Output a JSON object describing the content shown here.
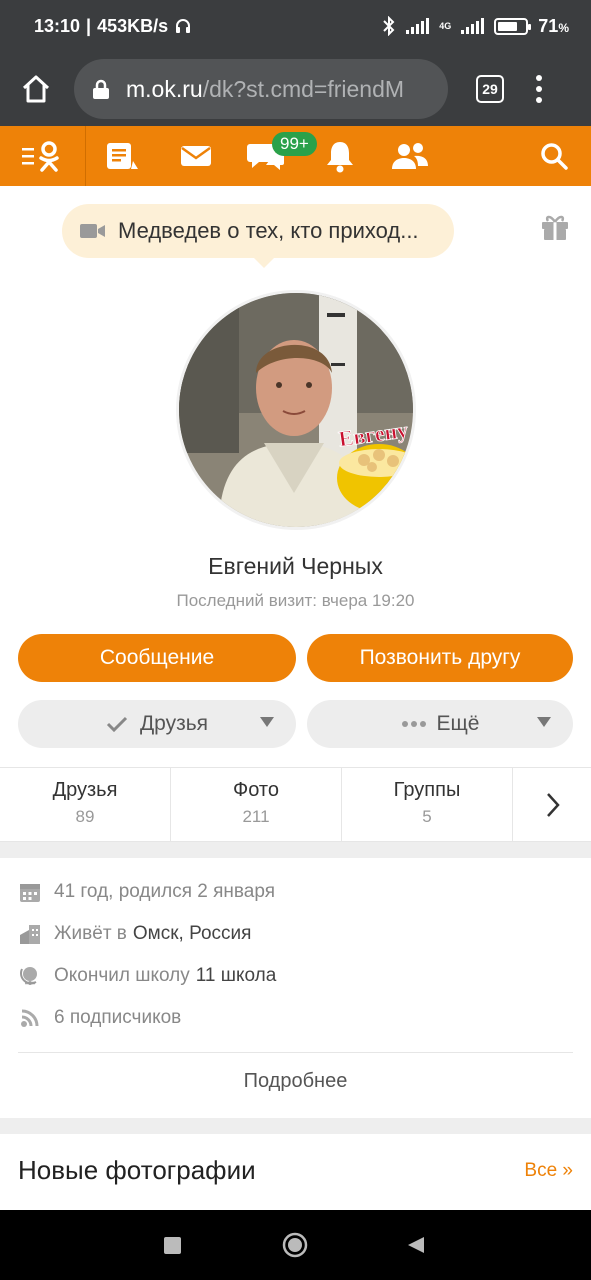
{
  "status_bar": {
    "time": "13:10",
    "speed": "453KB/s",
    "network": "4G",
    "battery": "71",
    "battery_unit": "%",
    "battery_level": 0.71
  },
  "browser": {
    "url_host": "m.ok.ru",
    "url_path": "/dk?st.cmd=friendM",
    "tab_count": "29"
  },
  "toolbar": {
    "items": [
      "menu-icon",
      "feed-icon",
      "mail-icon",
      "chat-icon",
      "bell-icon",
      "friends-icon",
      "search-icon"
    ],
    "chat_badge": "99+",
    "accent": "#ee8208",
    "badge_color": "#2aa14a"
  },
  "status_bubble": {
    "text": "Медведев о тех, кто приход..."
  },
  "profile": {
    "name": "Евгений Черных",
    "last_visit": "Последний визит: вчера 19:20",
    "avatar_sticker_text": "Евгену"
  },
  "actions": {
    "message_label": "Сообщение",
    "call_label": "Позвонить другу",
    "friends_label": "Друзья",
    "more_label": "Ещё"
  },
  "stats": [
    {
      "label": "Друзья",
      "count": "89"
    },
    {
      "label": "Фото",
      "count": "211"
    },
    {
      "label": "Группы",
      "count": "5"
    }
  ],
  "info": {
    "age": "41 год, родился 2 января",
    "lives_prefix": "Живёт в",
    "lives_value": "Омск, Россия",
    "school_prefix": "Окончил школу",
    "school_value": "11 школа",
    "subscribers": "6 подписчиков",
    "more_label": "Подробнее"
  },
  "new_photos": {
    "title": "Новые фотографии",
    "all_label": "Все »"
  }
}
